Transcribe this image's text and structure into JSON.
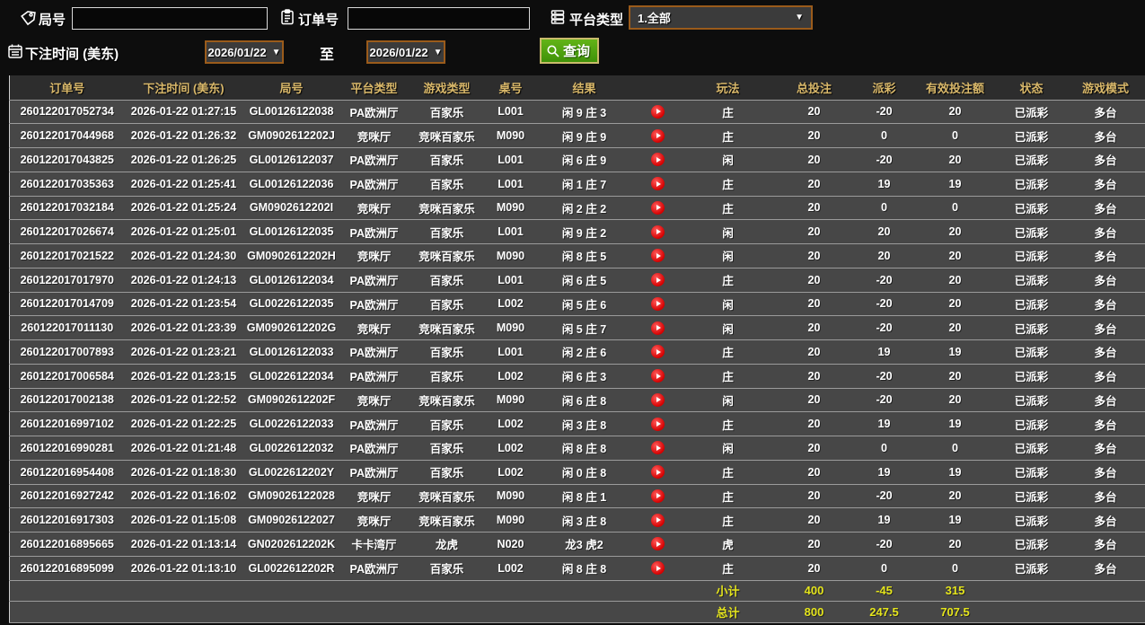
{
  "filters": {
    "round_label": "局号",
    "round_input_value": "",
    "order_label": "订单号",
    "order_input_value": "",
    "platform_label": "平台类型",
    "platform_value": "1.全部",
    "bet_time_label": "下注时间 (美东)",
    "date_from": "2026/01/22",
    "to_label": "至",
    "date_to": "2026/01/22",
    "query_label": "查询"
  },
  "table": {
    "headers": [
      "订单号",
      "下注时间 (美东)",
      "局号",
      "平台类型",
      "游戏类型",
      "桌号",
      "结果",
      "",
      "玩法",
      "总投注",
      "派彩",
      "有效投注额",
      "状态",
      "游戏模式"
    ],
    "rows": [
      {
        "order": "260122017052734",
        "time": "2026-01-22 01:27:15",
        "round": "GL00126122038",
        "platform": "PA欧洲厅",
        "game": "百家乐",
        "table_no": "L001",
        "result": "闲 9 庄 3",
        "bet_type": "庄",
        "total_bet": "20",
        "payout": "-20",
        "valid_bet": "20",
        "status": "已派彩",
        "mode": "多台"
      },
      {
        "order": "260122017044968",
        "time": "2026-01-22 01:26:32",
        "round": "GM0902612202J",
        "platform": "竞咪厅",
        "game": "竞咪百家乐",
        "table_no": "M090",
        "result": "闲 9 庄 9",
        "bet_type": "庄",
        "total_bet": "20",
        "payout": "0",
        "valid_bet": "0",
        "status": "已派彩",
        "mode": "多台"
      },
      {
        "order": "260122017043825",
        "time": "2026-01-22 01:26:25",
        "round": "GL00126122037",
        "platform": "PA欧洲厅",
        "game": "百家乐",
        "table_no": "L001",
        "result": "闲 6 庄 9",
        "bet_type": "闲",
        "total_bet": "20",
        "payout": "-20",
        "valid_bet": "20",
        "status": "已派彩",
        "mode": "多台"
      },
      {
        "order": "260122017035363",
        "time": "2026-01-22 01:25:41",
        "round": "GL00126122036",
        "platform": "PA欧洲厅",
        "game": "百家乐",
        "table_no": "L001",
        "result": "闲 1 庄 7",
        "bet_type": "庄",
        "total_bet": "20",
        "payout": "19",
        "valid_bet": "19",
        "status": "已派彩",
        "mode": "多台"
      },
      {
        "order": "260122017032184",
        "time": "2026-01-22 01:25:24",
        "round": "GM0902612202I",
        "platform": "竞咪厅",
        "game": "竞咪百家乐",
        "table_no": "M090",
        "result": "闲 2 庄 2",
        "bet_type": "庄",
        "total_bet": "20",
        "payout": "0",
        "valid_bet": "0",
        "status": "已派彩",
        "mode": "多台"
      },
      {
        "order": "260122017026674",
        "time": "2026-01-22 01:25:01",
        "round": "GL00126122035",
        "platform": "PA欧洲厅",
        "game": "百家乐",
        "table_no": "L001",
        "result": "闲 9 庄 2",
        "bet_type": "闲",
        "total_bet": "20",
        "payout": "20",
        "valid_bet": "20",
        "status": "已派彩",
        "mode": "多台"
      },
      {
        "order": "260122017021522",
        "time": "2026-01-22 01:24:30",
        "round": "GM0902612202H",
        "platform": "竞咪厅",
        "game": "竞咪百家乐",
        "table_no": "M090",
        "result": "闲 8 庄 5",
        "bet_type": "闲",
        "total_bet": "20",
        "payout": "20",
        "valid_bet": "20",
        "status": "已派彩",
        "mode": "多台"
      },
      {
        "order": "260122017017970",
        "time": "2026-01-22 01:24:13",
        "round": "GL00126122034",
        "platform": "PA欧洲厅",
        "game": "百家乐",
        "table_no": "L001",
        "result": "闲 6 庄 5",
        "bet_type": "庄",
        "total_bet": "20",
        "payout": "-20",
        "valid_bet": "20",
        "status": "已派彩",
        "mode": "多台"
      },
      {
        "order": "260122017014709",
        "time": "2026-01-22 01:23:54",
        "round": "GL00226122035",
        "platform": "PA欧洲厅",
        "game": "百家乐",
        "table_no": "L002",
        "result": "闲 5 庄 6",
        "bet_type": "闲",
        "total_bet": "20",
        "payout": "-20",
        "valid_bet": "20",
        "status": "已派彩",
        "mode": "多台"
      },
      {
        "order": "260122017011130",
        "time": "2026-01-22 01:23:39",
        "round": "GM0902612202G",
        "platform": "竞咪厅",
        "game": "竞咪百家乐",
        "table_no": "M090",
        "result": "闲 5 庄 7",
        "bet_type": "闲",
        "total_bet": "20",
        "payout": "-20",
        "valid_bet": "20",
        "status": "已派彩",
        "mode": "多台"
      },
      {
        "order": "260122017007893",
        "time": "2026-01-22 01:23:21",
        "round": "GL00126122033",
        "platform": "PA欧洲厅",
        "game": "百家乐",
        "table_no": "L001",
        "result": "闲 2 庄 6",
        "bet_type": "庄",
        "total_bet": "20",
        "payout": "19",
        "valid_bet": "19",
        "status": "已派彩",
        "mode": "多台"
      },
      {
        "order": "260122017006584",
        "time": "2026-01-22 01:23:15",
        "round": "GL00226122034",
        "platform": "PA欧洲厅",
        "game": "百家乐",
        "table_no": "L002",
        "result": "闲 6 庄 3",
        "bet_type": "庄",
        "total_bet": "20",
        "payout": "-20",
        "valid_bet": "20",
        "status": "已派彩",
        "mode": "多台"
      },
      {
        "order": "260122017002138",
        "time": "2026-01-22 01:22:52",
        "round": "GM0902612202F",
        "platform": "竞咪厅",
        "game": "竞咪百家乐",
        "table_no": "M090",
        "result": "闲 6 庄 8",
        "bet_type": "闲",
        "total_bet": "20",
        "payout": "-20",
        "valid_bet": "20",
        "status": "已派彩",
        "mode": "多台"
      },
      {
        "order": "260122016997102",
        "time": "2026-01-22 01:22:25",
        "round": "GL00226122033",
        "platform": "PA欧洲厅",
        "game": "百家乐",
        "table_no": "L002",
        "result": "闲 3 庄 8",
        "bet_type": "庄",
        "total_bet": "20",
        "payout": "19",
        "valid_bet": "19",
        "status": "已派彩",
        "mode": "多台"
      },
      {
        "order": "260122016990281",
        "time": "2026-01-22 01:21:48",
        "round": "GL00226122032",
        "platform": "PA欧洲厅",
        "game": "百家乐",
        "table_no": "L002",
        "result": "闲 8 庄 8",
        "bet_type": "闲",
        "total_bet": "20",
        "payout": "0",
        "valid_bet": "0",
        "status": "已派彩",
        "mode": "多台"
      },
      {
        "order": "260122016954408",
        "time": "2026-01-22 01:18:30",
        "round": "GL0022612202Y",
        "platform": "PA欧洲厅",
        "game": "百家乐",
        "table_no": "L002",
        "result": "闲 0 庄 8",
        "bet_type": "庄",
        "total_bet": "20",
        "payout": "19",
        "valid_bet": "19",
        "status": "已派彩",
        "mode": "多台"
      },
      {
        "order": "260122016927242",
        "time": "2026-01-22 01:16:02",
        "round": "GM09026122028",
        "platform": "竞咪厅",
        "game": "竞咪百家乐",
        "table_no": "M090",
        "result": "闲 8 庄 1",
        "bet_type": "庄",
        "total_bet": "20",
        "payout": "-20",
        "valid_bet": "20",
        "status": "已派彩",
        "mode": "多台"
      },
      {
        "order": "260122016917303",
        "time": "2026-01-22 01:15:08",
        "round": "GM09026122027",
        "platform": "竞咪厅",
        "game": "竞咪百家乐",
        "table_no": "M090",
        "result": "闲 3 庄 8",
        "bet_type": "庄",
        "total_bet": "20",
        "payout": "19",
        "valid_bet": "19",
        "status": "已派彩",
        "mode": "多台"
      },
      {
        "order": "260122016895665",
        "time": "2026-01-22 01:13:14",
        "round": "GN0202612202K",
        "platform": "卡卡湾厅",
        "game": "龙虎",
        "table_no": "N020",
        "result": "龙3 虎2",
        "bet_type": "虎",
        "total_bet": "20",
        "payout": "-20",
        "valid_bet": "20",
        "status": "已派彩",
        "mode": "多台"
      },
      {
        "order": "260122016895099",
        "time": "2026-01-22 01:13:10",
        "round": "GL0022612202R",
        "platform": "PA欧洲厅",
        "game": "百家乐",
        "table_no": "L002",
        "result": "闲 8 庄 8",
        "bet_type": "庄",
        "total_bet": "20",
        "payout": "0",
        "valid_bet": "0",
        "status": "已派彩",
        "mode": "多台"
      }
    ],
    "subtotal": {
      "label": "小计",
      "total_bet": "400",
      "payout": "-45",
      "valid_bet": "315"
    },
    "total": {
      "label": "总计",
      "total_bet": "800",
      "payout": "247.5",
      "valid_bet": "707.5"
    }
  },
  "colors": {
    "header_gold": "#d9b86a",
    "win_red": "#c22818",
    "loss_green": "#52d413",
    "status_green": "#2ad42a",
    "totals_yellow": "#e4e41c",
    "button_green": "#4f9e10",
    "select_border_orange": "#9a5b1b"
  }
}
